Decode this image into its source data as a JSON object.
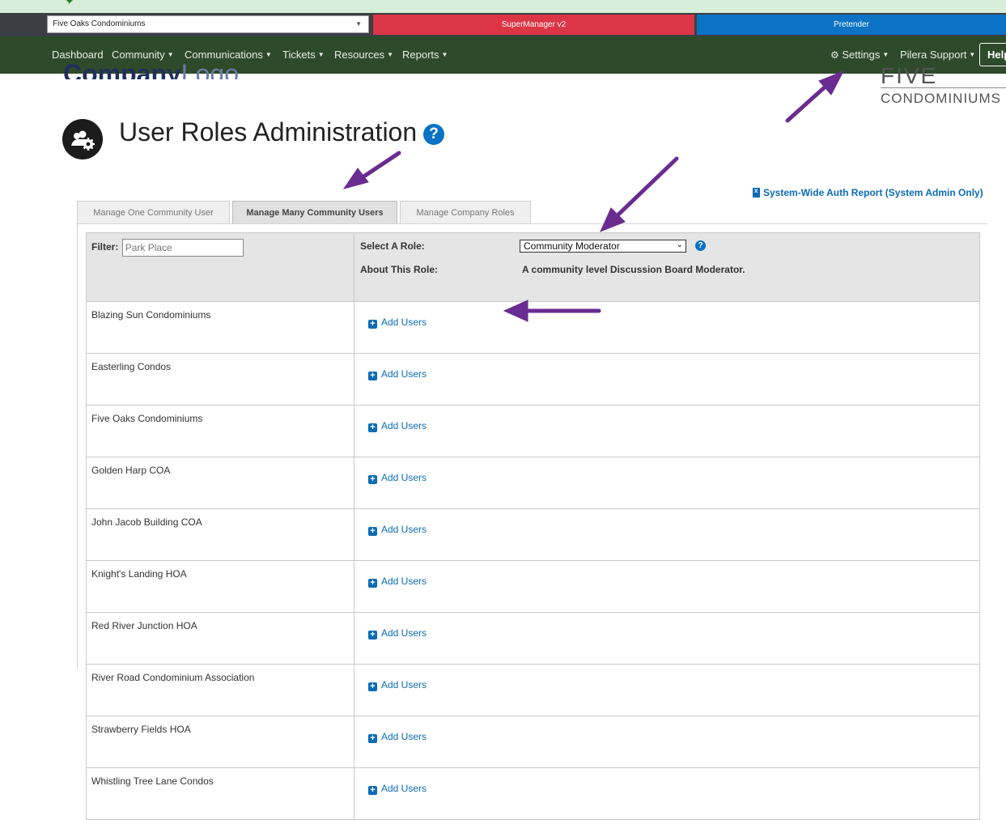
{
  "community_selector": {
    "value": "Five Oaks Condominiums"
  },
  "top_buttons": {
    "supermanager": "SuperManager v2",
    "pretender": "Pretender"
  },
  "nav": {
    "dashboard": "Dashboard",
    "community": "Community",
    "communications": "Communications",
    "tickets": "Tickets",
    "resources": "Resources",
    "reports": "Reports",
    "settings": "Settings",
    "pilera_support": "Pilera Support",
    "help": "Help"
  },
  "logos": {
    "company_bold": "Company",
    "company_light": "Logo",
    "community_line1": "FIVE OAKS",
    "community_line2": "CONDOMINIUMS"
  },
  "page": {
    "title": "User Roles Administration",
    "auth_report": "System-Wide Auth Report (System Admin Only)"
  },
  "tabs": [
    {
      "label": "Manage One Community User",
      "active": false
    },
    {
      "label": "Manage Many Community Users",
      "active": true
    },
    {
      "label": "Manage Company Roles",
      "active": false
    }
  ],
  "filter": {
    "label": "Filter:",
    "placeholder": "Park Place"
  },
  "role": {
    "select_label": "Select A Role:",
    "selected": "Community Moderator",
    "about_label": "About This Role:",
    "about_text": "A community level Discussion Board Moderator."
  },
  "add_users_label": "Add Users",
  "communities": [
    "Blazing Sun Condominiums",
    "Easterling Condos",
    "Five Oaks Condominiums",
    "Golden Harp COA",
    "John Jacob Building COA",
    "Knight's Landing HOA",
    "Red River Junction HOA",
    "River Road Condominium Association",
    "Strawberry Fields HOA",
    "Whistling Tree Lane Condos"
  ],
  "colors": {
    "nav_bg": "#2d4a2a",
    "supermanager": "#dc3545",
    "pretender": "#0b72c4",
    "link": "#0b6bb5",
    "annotation_arrow": "#6a2c91"
  },
  "icons": {
    "settings": "gear-icon",
    "title": "users-cog-icon",
    "help": "question-circle-icon",
    "report": "excel-file-icon",
    "add": "plus-square-icon"
  }
}
